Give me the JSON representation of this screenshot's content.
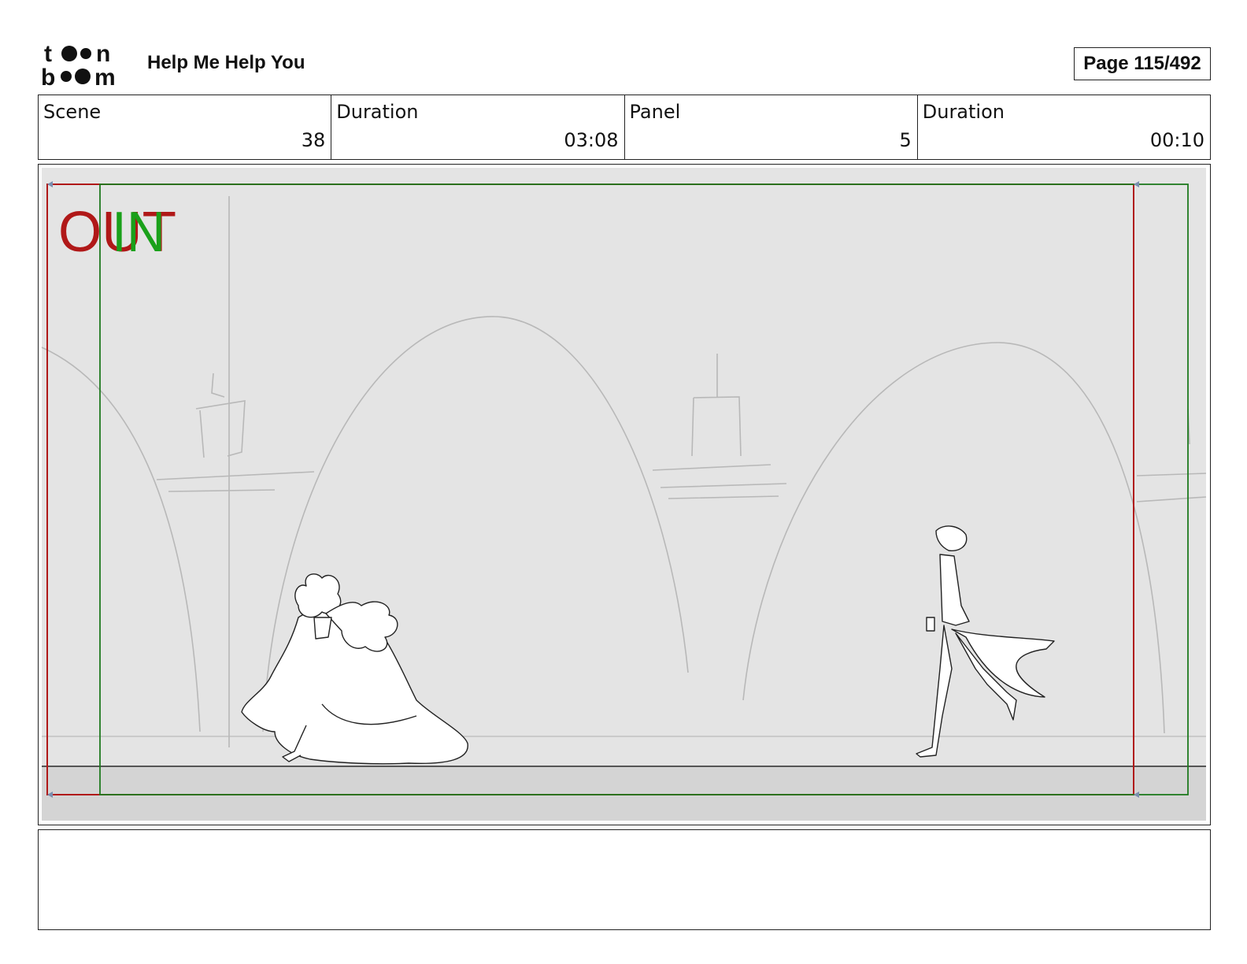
{
  "header": {
    "logo_text": "toon boom",
    "project_title": "Help Me Help You",
    "page_label": "Page 115/492"
  },
  "info": {
    "scene_label": "Scene",
    "scene_value": "38",
    "scene_duration_label": "Duration",
    "scene_duration_value": "03:08",
    "panel_label": "Panel",
    "panel_value": "5",
    "panel_duration_label": "Duration",
    "panel_duration_value": "00:10"
  },
  "panel": {
    "overlay_out": "OUT",
    "overlay_in": "IN",
    "colors": {
      "out_frame": "#b01818",
      "in_frame": "#1e7a1e",
      "background": "#e4e4e4",
      "floor": "#d4d4d4"
    }
  },
  "notes": {
    "text": ""
  }
}
